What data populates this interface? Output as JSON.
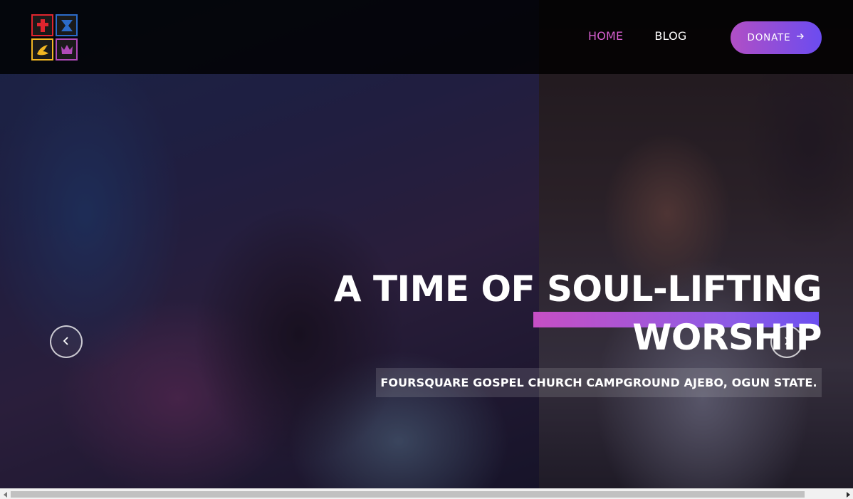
{
  "header": {
    "logo_icons": [
      "cross-icon",
      "cup-icon",
      "dove-icon",
      "crown-icon"
    ],
    "nav": [
      {
        "label": "HOME",
        "active": true
      },
      {
        "label": "BLOG",
        "active": false
      }
    ],
    "donate_label": "DONATE",
    "donate_icon": "arrow-right-icon"
  },
  "hero": {
    "title_line1": "A TIME OF SOUL-LIFTING",
    "title_line2": "WORSHIP",
    "subtitle": "FOURSQUARE GOSPEL CHURCH CAMPGROUND AJEBO, OGUN STATE.",
    "prev_icon": "chevron-left-icon",
    "next_icon": "chevron-right-icon"
  },
  "colors": {
    "accent_pink": "#d65fd0",
    "gradient_start": "#b14fc5",
    "gradient_end": "#6b4cf0"
  }
}
